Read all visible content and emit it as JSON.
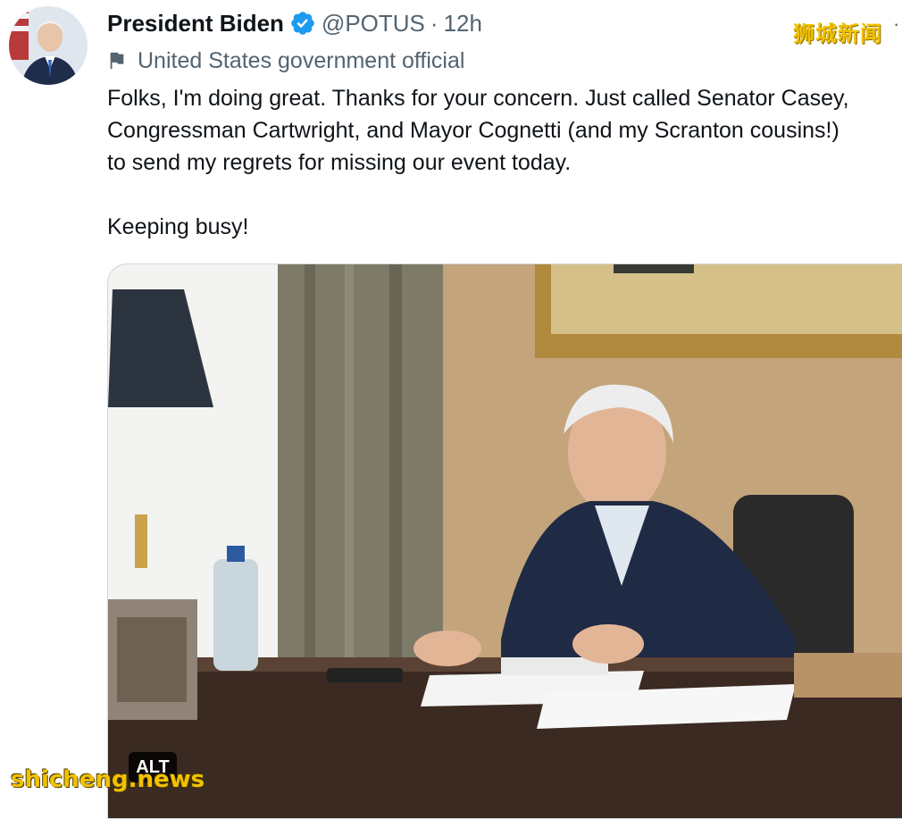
{
  "tweet": {
    "author_name": "President Biden",
    "handle": "@POTUS",
    "separator": "·",
    "time": "12h",
    "more_label": "·",
    "affiliation": "United States government official",
    "lines": [
      "Folks, I'm doing great. Thanks for your concern. Just called Senator Casey,",
      "Congressman Cartwright, and Mayor Cognetti (and my Scranton cousins!)",
      "to send my regrets for missing our event today."
    ],
    "closing_line": "Keeping busy!",
    "media_alt_badge": "ALT"
  },
  "watermarks": {
    "top": "狮城新闻",
    "bottom": "shicheng.news"
  },
  "colors": {
    "verified_blue": "#1d9bf0",
    "muted_text": "#536471",
    "watermark_yellow": "#f2c200"
  },
  "icons": {
    "verified": "verified-badge-icon",
    "affiliation": "flag-icon"
  }
}
